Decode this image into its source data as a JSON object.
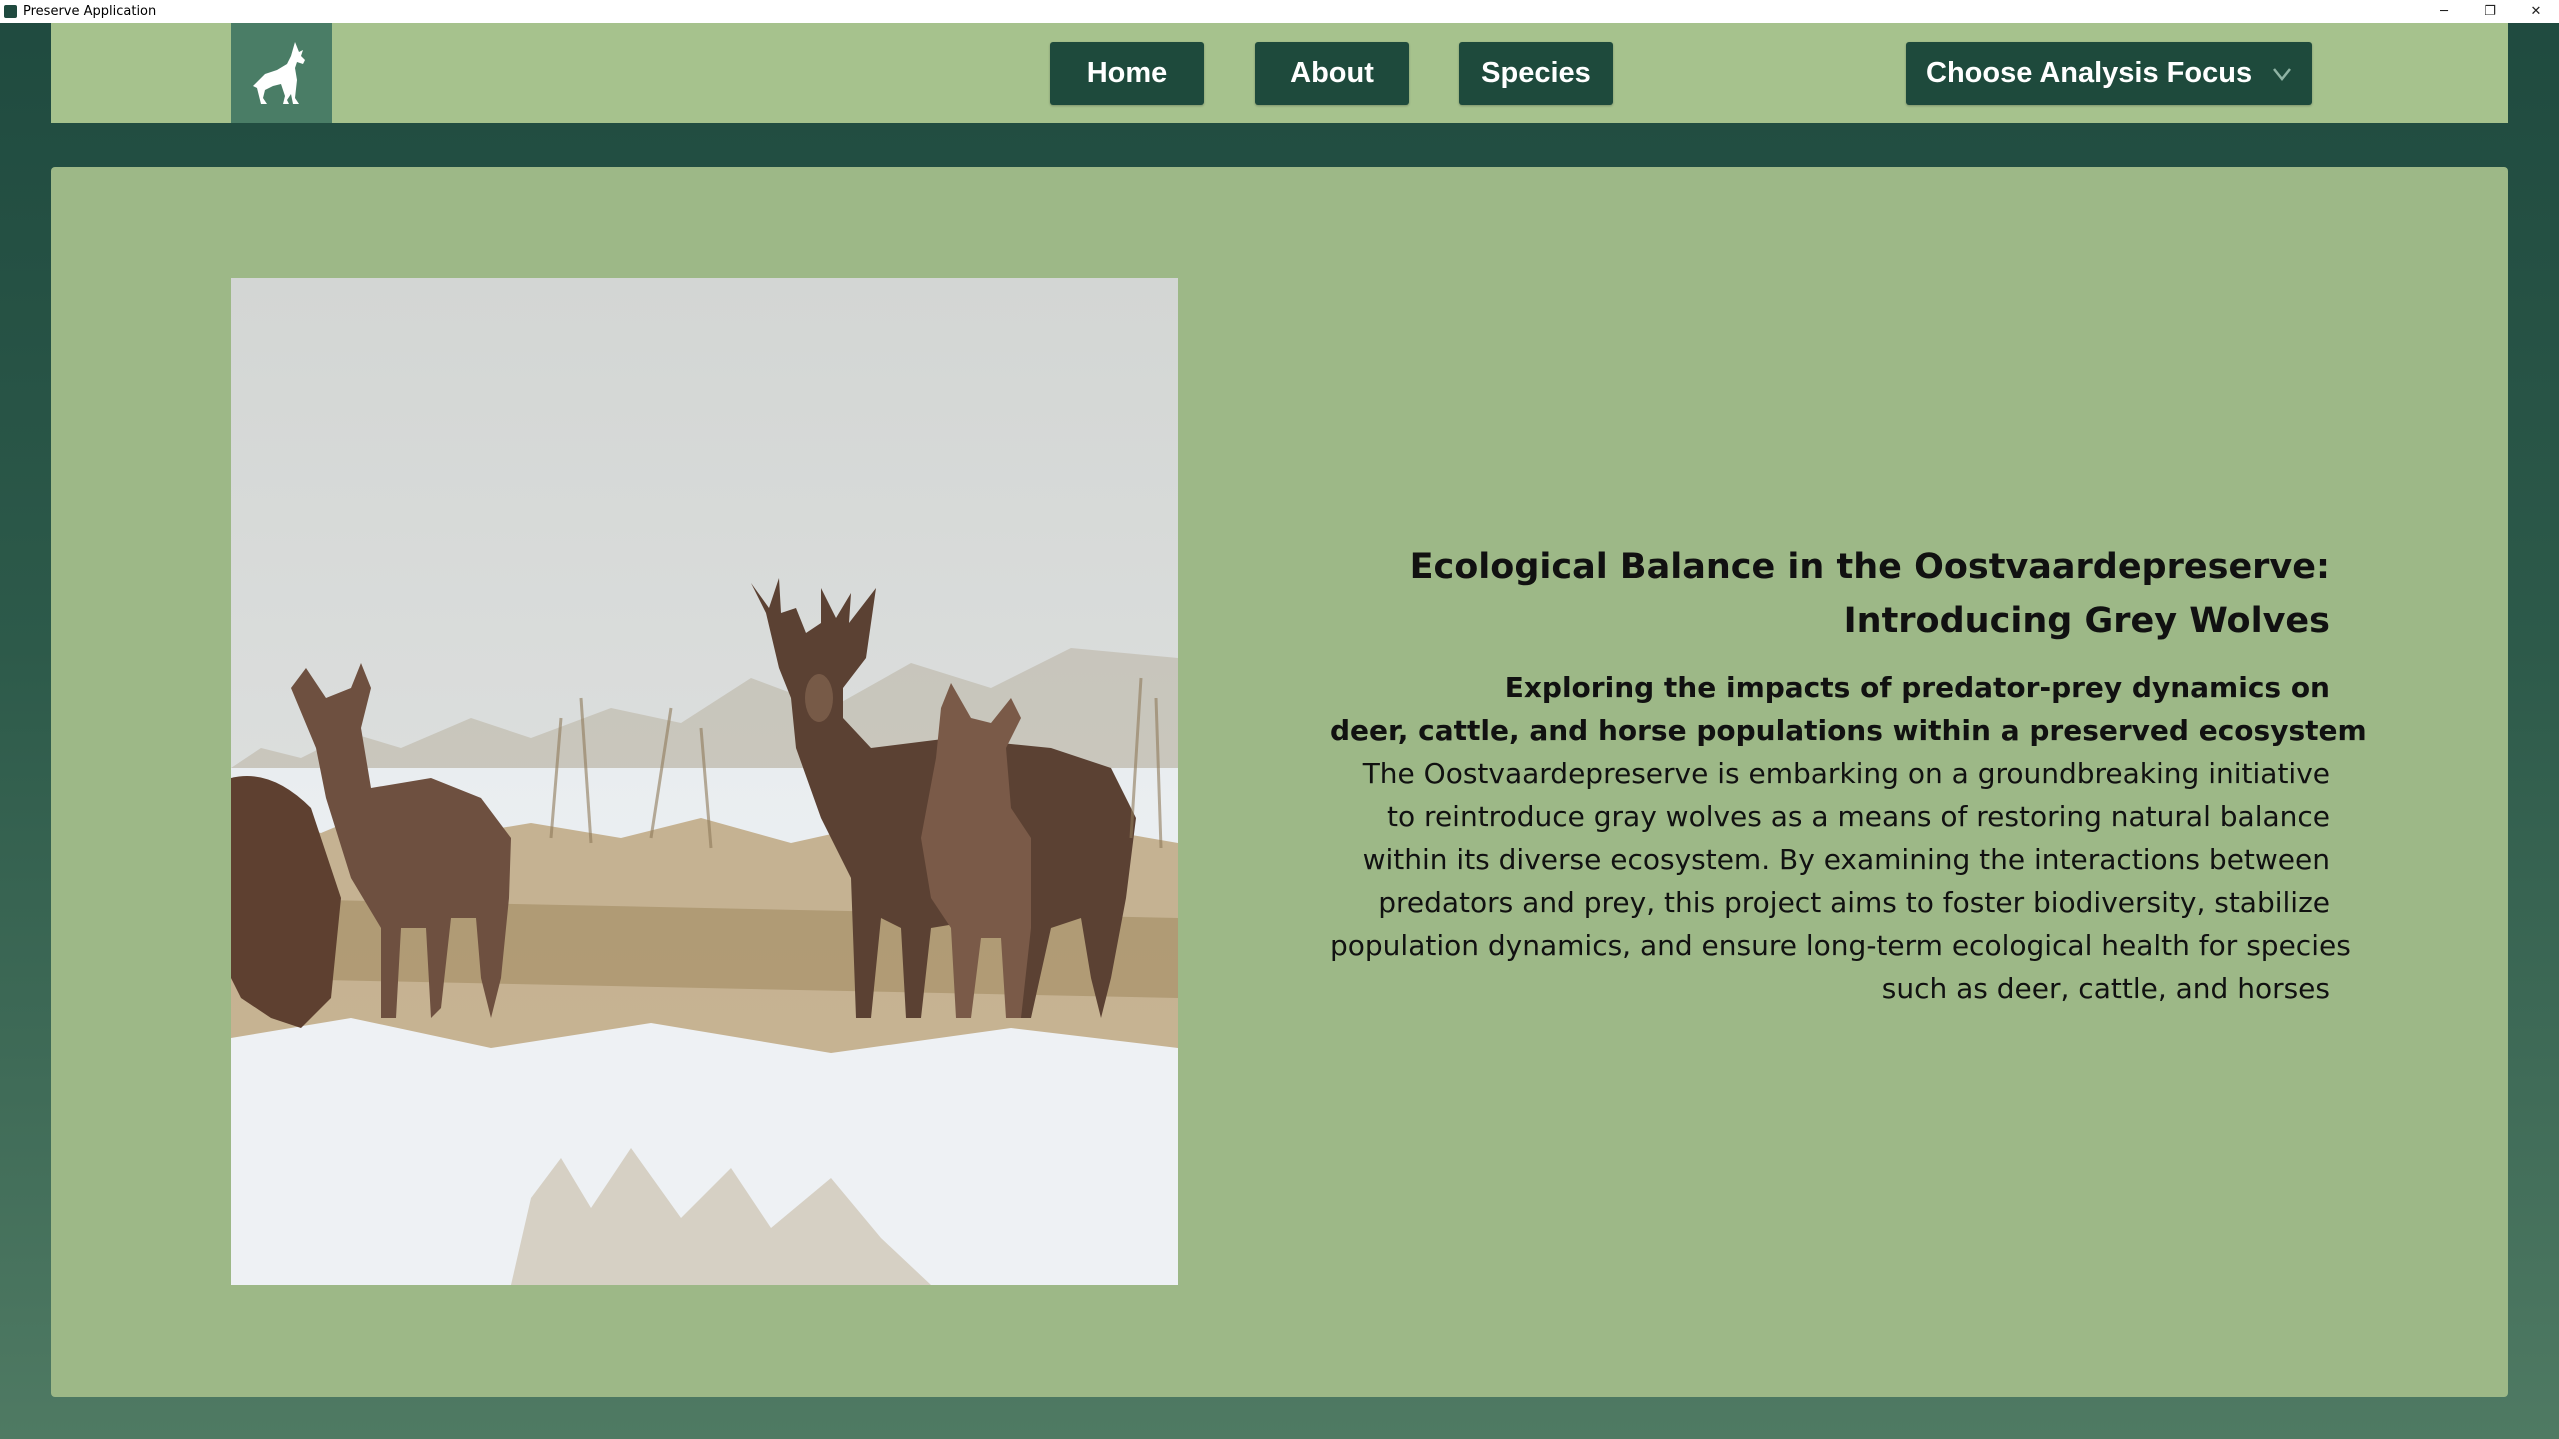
{
  "window": {
    "title": "Preserve Application",
    "minimize_glyph": "─",
    "restore_glyph": "❐",
    "close_glyph": "✕"
  },
  "nav": {
    "logo_icon": "howling-wolf-icon",
    "home_label": "Home",
    "about_label": "About",
    "species_label": "Species",
    "dropdown_label": "Choose Analysis Focus",
    "dropdown_icon": "caret-down-icon"
  },
  "content": {
    "image_subject": "red-deer-in-snow-photo",
    "headline_lines": [
      "Ecological Balance in the Oostvaardepreserve:",
      "Introducing Grey Wolves"
    ],
    "subhead_lines": [
      "Exploring the impacts of predator-prey dynamics on",
      "deer, cattle, and horse populations within a preserved ecosystem"
    ],
    "body_lines": [
      "The Oostvaardepreserve is embarking on a groundbreaking initiative",
      "to reintroduce gray wolves as a means of restoring natural balance",
      "within its diverse ecosystem. By examining the interactions between",
      "predators and prey, this project aims to foster biodiversity, stabilize",
      "population dynamics, and ensure long-term ecological health for species",
      "such as deer, cattle, and horses"
    ]
  },
  "colors": {
    "background_dark": "#1f4a3f",
    "navbar": "#a6c28d",
    "card": "#9db887",
    "button": "#1e4a3c",
    "logo_box": "#4a7d66"
  }
}
